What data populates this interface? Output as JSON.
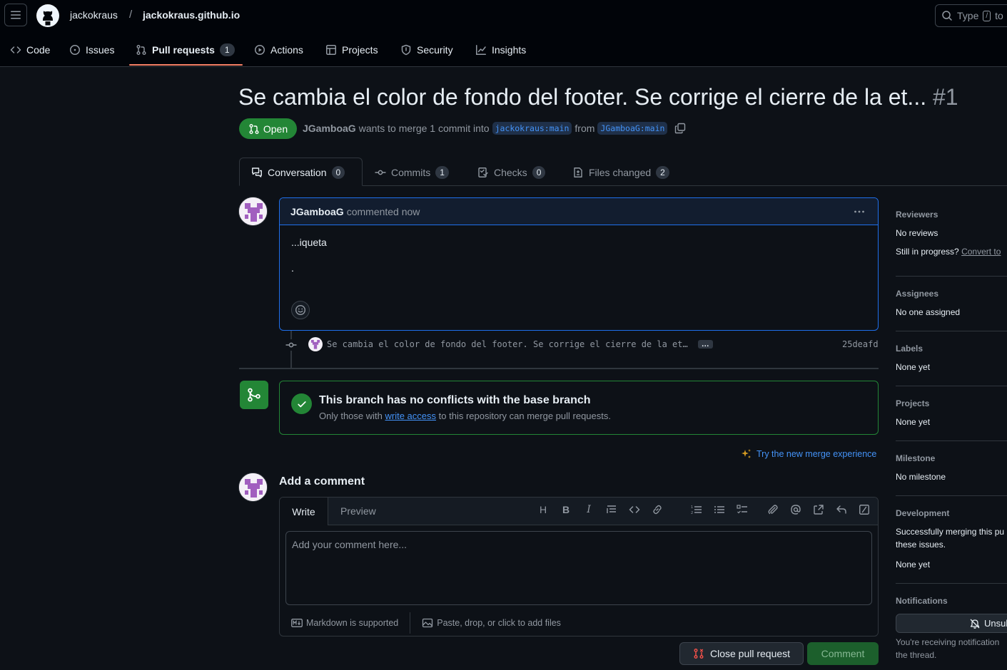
{
  "header": {
    "owner": "jackokraus",
    "separator": "/",
    "repo": "jackokraus.github.io",
    "search_placeholder": "Type",
    "search_key": "/",
    "search_suffix": "to"
  },
  "repo_nav": {
    "code": "Code",
    "issues": "Issues",
    "pull_requests": "Pull requests",
    "pull_requests_count": "1",
    "actions": "Actions",
    "projects": "Projects",
    "security": "Security",
    "insights": "Insights"
  },
  "pr": {
    "title": "Se cambia el color de fondo del footer. Se corrige el cierre de la et...",
    "number": "#1",
    "state": "Open",
    "author": "JGamboaG",
    "merge_text": "wants to merge 1 commit into",
    "base_branch": "jackokraus:main",
    "from_text": "from",
    "head_branch": "JGamboaG:main"
  },
  "tabs": {
    "conversation": "Conversation",
    "conversation_count": "0",
    "commits": "Commits",
    "commits_count": "1",
    "checks": "Checks",
    "checks_count": "0",
    "files": "Files changed",
    "files_count": "2"
  },
  "comment": {
    "author": "JGamboaG",
    "meta": "commented now",
    "body_line1": "...iqueta",
    "body_line2": "."
  },
  "commit": {
    "message": "Se cambia el color de fondo del footer. Se corrige el cierre de la et…",
    "ellipsis": "…",
    "sha": "25deafd"
  },
  "merge": {
    "title": "This branch has no conflicts with the base branch",
    "sub_before": "Only those with",
    "sub_link": "write access",
    "sub_after": "to this repository can merge pull requests.",
    "try_new": "Try the new merge experience"
  },
  "add_comment": {
    "title": "Add a comment",
    "write_tab": "Write",
    "preview_tab": "Preview",
    "placeholder": "Add your comment here...",
    "markdown": "Markdown is supported",
    "paste": "Paste, drop, or click to add files",
    "close_button": "Close pull request",
    "comment_button": "Comment"
  },
  "sidebar": {
    "reviewers_h": "Reviewers",
    "reviewers_v": "No reviews",
    "progress_q": "Still in progress?",
    "convert_link": "Convert to",
    "assignees_h": "Assignees",
    "assignees_v": "No one assigned",
    "labels_h": "Labels",
    "labels_v": "None yet",
    "projects_h": "Projects",
    "projects_v": "None yet",
    "milestone_h": "Milestone",
    "milestone_v": "No milestone",
    "development_h": "Development",
    "development_l1": "Successfully merging this pu",
    "development_l2": "these issues.",
    "development_v": "None yet",
    "notifications_h": "Notifications",
    "unsubscribe": "Unsub",
    "notif_l1": "You're receiving notification",
    "notif_l2": "the thread."
  },
  "colors": {
    "background": "#0d1117",
    "accent_green": "#238636",
    "link_blue": "#4493f8",
    "tab_underline": "#f78166"
  }
}
